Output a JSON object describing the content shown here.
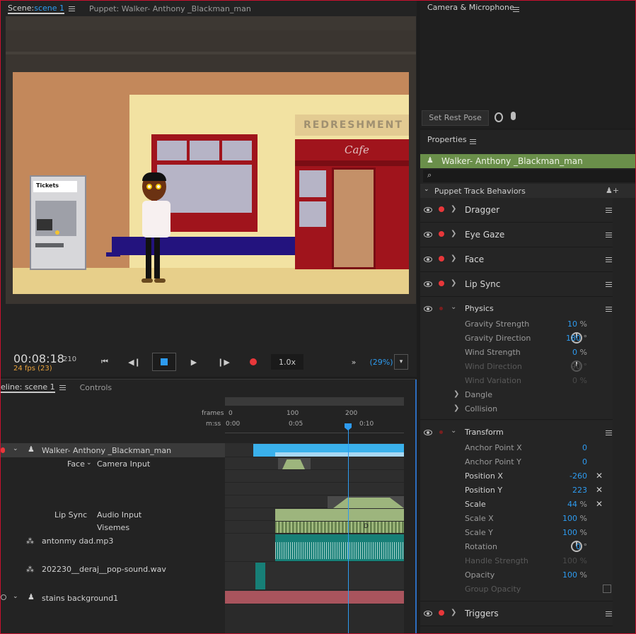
{
  "scene_tabs": {
    "scene_prefix": "Scene:",
    "scene_name": "scene 1",
    "puppet_tab": "Puppet: Walker- Anthony _Blackman_man"
  },
  "stage": {
    "tickets_label": "Tickets",
    "shop_sign": "REDRESHMENT",
    "cafe_sign": "Cafe"
  },
  "transport": {
    "timecode": "00:08:18",
    "frame": "210",
    "fps": "24 fps (23)",
    "speed": "1.0x",
    "zoom": "(29%)"
  },
  "timeline": {
    "tab_label": "eline: scene 1",
    "controls_tab": "Controls",
    "ruler": {
      "frames_label": "frames",
      "time_label": "m:ss",
      "frame_ticks": [
        "0",
        "100",
        "200"
      ],
      "time_ticks": [
        "0:00",
        "0:05",
        "0:10"
      ]
    },
    "tracks": {
      "puppet": "Walker- Anthony _Blackman_man",
      "face": "Face",
      "camera_input": "Camera Input",
      "lip_sync": "Lip Sync",
      "audio_input": "Audio Input",
      "visemes": "Visemes",
      "viseme_letter": "D",
      "audio1": "antonmy dad.mp3",
      "audio2": "202230__deraj__pop-sound.wav",
      "background": "stains background1"
    }
  },
  "camera": {
    "title": "Camera & Microphone",
    "rest_pose": "Set Rest Pose"
  },
  "properties": {
    "title": "Properties",
    "puppet_name": "Walker- Anthony _Blackman_man",
    "section": "Puppet Track Behaviors",
    "behaviors": [
      "Dragger",
      "Eye Gaze",
      "Face",
      "Lip Sync"
    ],
    "physics": {
      "title": "Physics",
      "params": [
        {
          "name": "Gravity Strength",
          "value": "10",
          "unit": "%"
        },
        {
          "name": "Gravity Direction",
          "value": "180",
          "unit": "°"
        },
        {
          "name": "Wind Strength",
          "value": "0",
          "unit": "%"
        },
        {
          "name": "Wind Direction",
          "value": "90",
          "unit": "°"
        },
        {
          "name": "Wind Variation",
          "value": "0",
          "unit": "%"
        }
      ],
      "sub": [
        "Dangle",
        "Collision"
      ]
    },
    "transform": {
      "title": "Transform",
      "params": [
        {
          "name": "Anchor Point X",
          "value": "0",
          "unit": ""
        },
        {
          "name": "Anchor Point Y",
          "value": "0",
          "unit": ""
        },
        {
          "name": "Position X",
          "value": "-260",
          "unit": ""
        },
        {
          "name": "Position Y",
          "value": "223",
          "unit": ""
        },
        {
          "name": "Scale",
          "value": "44",
          "unit": "%"
        },
        {
          "name": "Scale X",
          "value": "100",
          "unit": "%"
        },
        {
          "name": "Scale Y",
          "value": "100",
          "unit": "%"
        },
        {
          "name": "Rotation",
          "value": "0",
          "unit": "°"
        },
        {
          "name": "Handle Strength",
          "value": "100",
          "unit": "%"
        },
        {
          "name": "Opacity",
          "value": "100",
          "unit": "%"
        },
        {
          "name": "Group Opacity",
          "value": "",
          "unit": ""
        }
      ]
    },
    "triggers": "Triggers"
  }
}
